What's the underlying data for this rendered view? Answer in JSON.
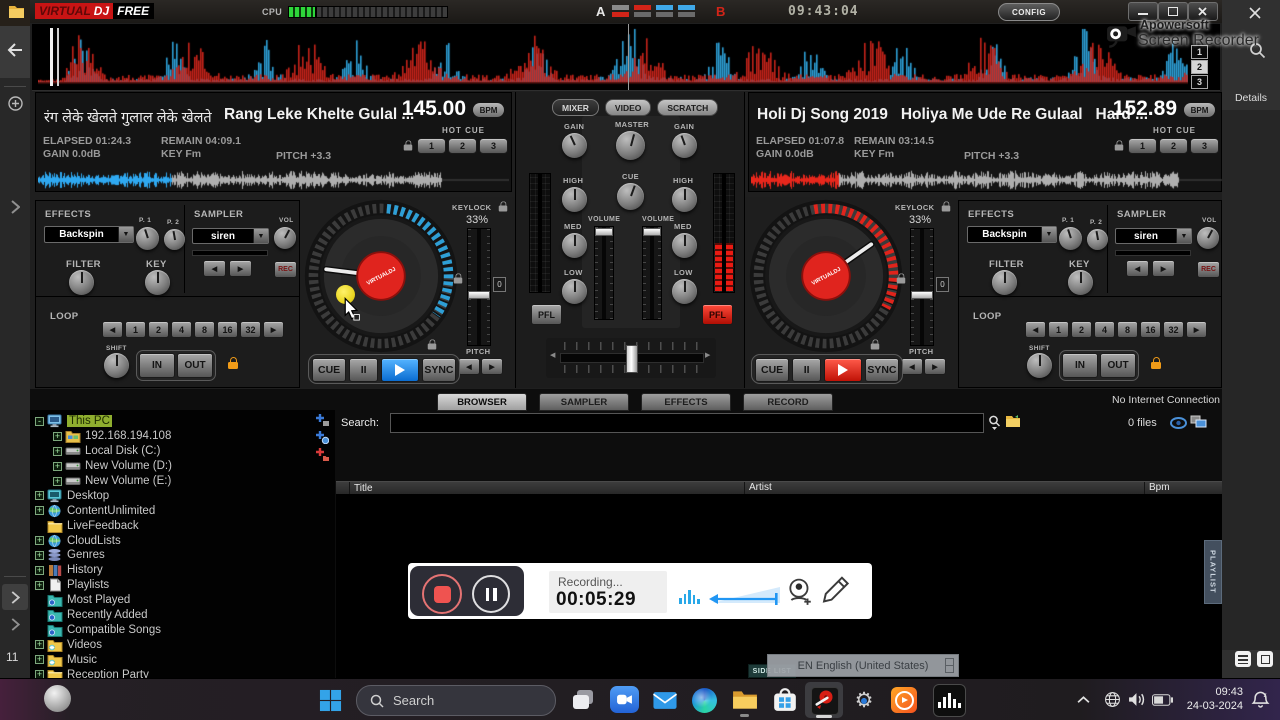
{
  "titlebar": {
    "logo_virtual": "VIRTUAL",
    "logo_dj": "DJ",
    "logo_free": "FREE",
    "cpu_label": "CPU",
    "deck_a_label": "A",
    "deck_b_label": "B",
    "clock": "09:43:04",
    "config_label": "CONFIG"
  },
  "recorder": {
    "brand_line1": "Apowersoft",
    "brand_line2": "Screen Recorder",
    "details_label": "Details",
    "status": "Recording...",
    "time": "00:05:29"
  },
  "rhythm": {
    "zoom_levels": [
      "1",
      "2",
      "3"
    ]
  },
  "deck_labels": {
    "bpm": "BPM",
    "elapsed": "ELAPSED",
    "remain": "REMAIN",
    "gain": "GAIN",
    "key": "KEY",
    "pitch": "PITCH",
    "hot_cue": "HOT CUE",
    "hotcues": [
      "1",
      "2",
      "3"
    ]
  },
  "deck_left": {
    "title_native": "रंग लेके खेलते गुलाल लेके खेलते",
    "title": "Rang Leke Khelte Gulal ...",
    "bpm": "145.00",
    "elapsed": "01:24.3",
    "remain": "04:09.1",
    "gain": "0.0dB",
    "key": "Fm",
    "pitch": "+3.3"
  },
  "deck_right": {
    "title": "Holi Dj Song 2019   Holiya Me Ude Re Gulaal   Hard ...",
    "bpm": "152.89",
    "elapsed": "01:07.8",
    "remain": "03:14.5",
    "gain": "0.0dB",
    "key": "Fm",
    "pitch": "+3.3"
  },
  "fx": {
    "effects_label": "EFFECTS",
    "effect_name": "Backspin",
    "p1_label": "P. 1",
    "p2_label": "P. 2",
    "sampler_label": "SAMPLER",
    "sample_name": "siren",
    "vol_label": "VOL",
    "rec_label": "REC",
    "filter_label": "FILTER",
    "key_label": "KEY",
    "loop_label": "LOOP",
    "loop_values": [
      "1",
      "2",
      "4",
      "8",
      "16",
      "32"
    ],
    "shift_label": "SHIFT",
    "in_label": "IN",
    "out_label": "OUT"
  },
  "jog": {
    "keylock_label": "KEYLOCK",
    "pitch_percent": "33%",
    "reset_label": "0",
    "pitch_label": "PITCH",
    "center_logo": "VIRTUALDJ"
  },
  "transport": {
    "cue": "CUE",
    "pause": "II",
    "sync": "SYNC"
  },
  "mixer": {
    "tabs": [
      "MIXER",
      "VIDEO",
      "SCRATCH"
    ],
    "gain_label": "GAIN",
    "master_label": "MASTER",
    "cue_label": "CUE",
    "high_label": "HIGH",
    "med_label": "MED",
    "low_label": "LOW",
    "volume_label": "VOLUME",
    "pfl_label": "PFL"
  },
  "browser": {
    "tabs": [
      "BROWSER",
      "SAMPLER",
      "EFFECTS",
      "RECORD"
    ],
    "search_label": "Search:",
    "search_value": "",
    "files_count": "0 files",
    "no_internet": "No Internet Connection",
    "columns": [
      "Title",
      "Artist",
      "Bpm"
    ],
    "side_list_label": "SIDE LIST",
    "playlist_tab": "PLAYLIST",
    "tree": [
      {
        "label": "This PC",
        "icon": "computer-icon",
        "toggle": "-",
        "indent": 0,
        "selected": true
      },
      {
        "label": "192.168.194.108",
        "icon": "network-folder-icon",
        "toggle": "+",
        "indent": 1
      },
      {
        "label": "Local Disk (C:)",
        "icon": "drive-icon",
        "toggle": "+",
        "indent": 1
      },
      {
        "label": "New Volume (D:)",
        "icon": "drive-icon",
        "toggle": "+",
        "indent": 1
      },
      {
        "label": "New Volume (E:)",
        "icon": "drive-icon",
        "toggle": "+",
        "indent": 1
      },
      {
        "label": "Desktop",
        "icon": "desktop-icon",
        "toggle": "+",
        "indent": 0
      },
      {
        "label": "ContentUnlimited",
        "icon": "globe-icon",
        "toggle": "+",
        "indent": 0
      },
      {
        "label": "LiveFeedback",
        "icon": "folder-icon",
        "toggle": "",
        "indent": 0
      },
      {
        "label": "CloudLists",
        "icon": "globe-icon",
        "toggle": "+",
        "indent": 0
      },
      {
        "label": "Genres",
        "icon": "genres-icon",
        "toggle": "+",
        "indent": 0
      },
      {
        "label": "History",
        "icon": "history-icon",
        "toggle": "+",
        "indent": 0
      },
      {
        "label": "Playlists",
        "icon": "playlist-icon",
        "toggle": "+",
        "indent": 0
      },
      {
        "label": "Most Played",
        "icon": "smart-folder-icon",
        "toggle": "",
        "indent": 0
      },
      {
        "label": "Recently Added",
        "icon": "smart-folder-icon",
        "toggle": "",
        "indent": 0
      },
      {
        "label": "Compatible Songs",
        "icon": "smart-folder-icon",
        "toggle": "",
        "indent": 0
      },
      {
        "label": "Videos",
        "icon": "media-folder-icon",
        "toggle": "+",
        "indent": 0
      },
      {
        "label": "Music",
        "icon": "media-folder-icon",
        "toggle": "+",
        "indent": 0
      },
      {
        "label": "Reception Party",
        "icon": "folder-icon",
        "toggle": "+",
        "indent": 0
      }
    ]
  },
  "language_bar": {
    "text": "EN English (United States)"
  },
  "taskbar": {
    "search_placeholder": "Search",
    "time": "09:43",
    "date": "24-03-2024"
  },
  "side_strip": {
    "page_number": "11"
  }
}
